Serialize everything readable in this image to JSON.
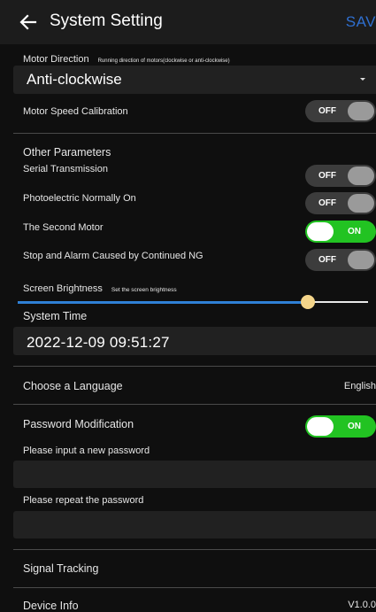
{
  "header": {
    "title": "System Setting",
    "save_label": "SAV"
  },
  "motor_direction": {
    "label": "Motor Direction",
    "hint": "Running direction of motors(clockwise or anti-clockwise)",
    "selected": "Anti-clockwise"
  },
  "motor_speed_calibration": {
    "label": "Motor Speed Calibration",
    "state": "OFF"
  },
  "other_parameters": {
    "title": "Other Parameters",
    "items": [
      {
        "label": "Serial Transmission",
        "state": "OFF"
      },
      {
        "label": "Photoelectric Normally On",
        "state": "OFF"
      },
      {
        "label": "The Second Motor",
        "state": "ON"
      },
      {
        "label": "Stop and Alarm Caused by Continued NG",
        "state": "OFF"
      }
    ]
  },
  "screen_brightness": {
    "label": "Screen Brightness",
    "hint": "Set the screen brightness",
    "level": 0.83
  },
  "system_time": {
    "label": "System Time",
    "value": "2022-12-09 09:51:27"
  },
  "language": {
    "label": "Choose a Language",
    "value": "English"
  },
  "password": {
    "label": "Password Modification",
    "state": "ON",
    "new_label": "Please input a new password",
    "new_value": "",
    "repeat_label": "Please repeat the password",
    "repeat_value": ""
  },
  "signal_tracking": {
    "label": "Signal Tracking"
  },
  "device_info": {
    "label": "Device Info",
    "value": "V1.0.0"
  },
  "colors": {
    "accent": "#2f6fd0",
    "toggle_on": "#22c322",
    "slider": "#2f80d6",
    "thumb": "#f4d58a"
  }
}
